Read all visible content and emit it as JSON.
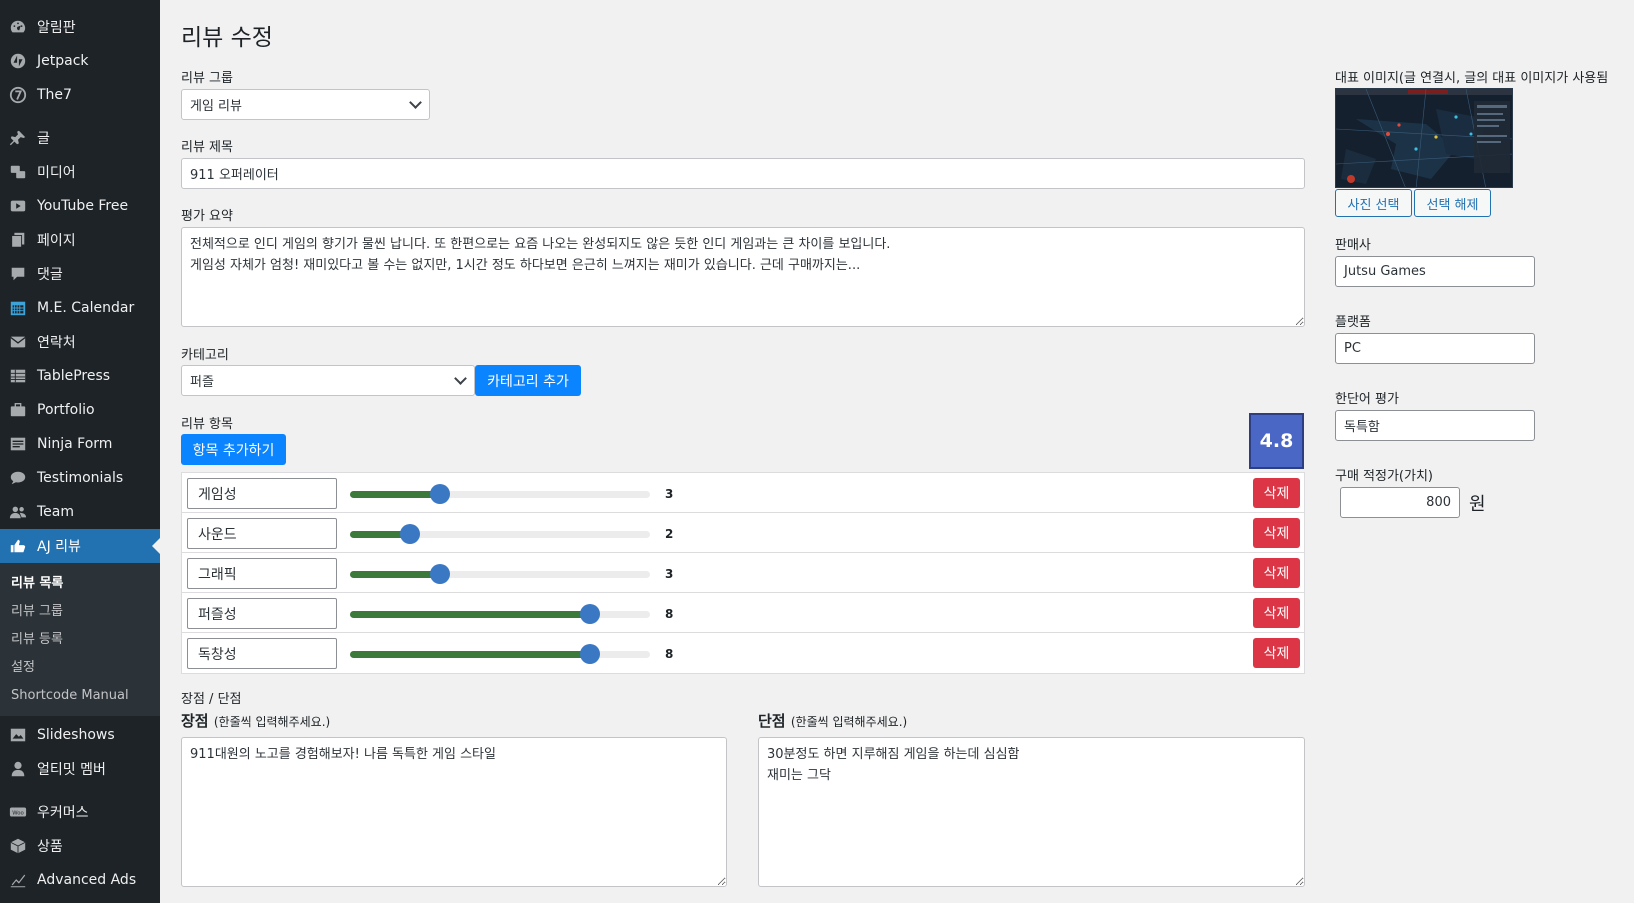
{
  "sidebar": {
    "items": [
      {
        "label": "알림판",
        "icon": "dashboard-icon"
      },
      {
        "label": "Jetpack",
        "icon": "jetpack-icon"
      },
      {
        "label": "The7",
        "icon": "the7-icon"
      },
      {
        "label": "글",
        "icon": "pin-icon"
      },
      {
        "label": "미디어",
        "icon": "media-icon"
      },
      {
        "label": "YouTube Free",
        "icon": "youtube-icon"
      },
      {
        "label": "페이지",
        "icon": "page-icon"
      },
      {
        "label": "댓글",
        "icon": "comment-icon"
      },
      {
        "label": "M.E. Calendar",
        "icon": "calendar-icon"
      },
      {
        "label": "연락처",
        "icon": "mail-icon"
      },
      {
        "label": "TablePress",
        "icon": "table-icon"
      },
      {
        "label": "Portfolio",
        "icon": "portfolio-icon"
      },
      {
        "label": "Ninja Form",
        "icon": "form-icon"
      },
      {
        "label": "Testimonials",
        "icon": "testimonial-icon"
      },
      {
        "label": "Team",
        "icon": "team-icon"
      },
      {
        "label": "AJ 리뷰",
        "icon": "thumbs-up-icon"
      },
      {
        "label": "Slideshows",
        "icon": "slideshow-icon"
      },
      {
        "label": "얼티밋 멤버",
        "icon": "member-icon"
      },
      {
        "label": "우커머스",
        "icon": "woocommerce-icon"
      },
      {
        "label": "상품",
        "icon": "product-icon"
      },
      {
        "label": "Advanced Ads",
        "icon": "chart-icon"
      }
    ],
    "submenu": [
      "리뷰 목록",
      "리뷰 그룹",
      "리뷰 등록",
      "설정",
      "Shortcode Manual"
    ]
  },
  "page": {
    "title": "리뷰 수정",
    "group_label": "리뷰 그룹",
    "group_value": "게임 리뷰",
    "title_label": "리뷰 제목",
    "title_value": "911 오퍼레이터",
    "summary_label": "평가 요약",
    "summary_value": "전체적으로 인디 게임의 향기가 물씬 납니다. 또 한편으로는 요즘 나오는 완성되지도 않은 듯한 인디 게임과는 큰 차이를 보입니다.\n게임성 자체가 엄청! 재미있다고 볼 수는 없지만, 1시간 정도 하다보면 은근히 느껴지는 재미가 있습니다. 근데 구매까지는...",
    "category_label": "카테고리",
    "category_value": "퍼즐",
    "category_add": "카테고리 추가",
    "items_label": "리뷰 항목",
    "items_add": "항목 추가하기",
    "score": "4.8",
    "items": [
      {
        "name": "게임성",
        "value": 3
      },
      {
        "name": "사운드",
        "value": 2
      },
      {
        "name": "그래픽",
        "value": 3
      },
      {
        "name": "퍼즐성",
        "value": 8
      },
      {
        "name": "독창성",
        "value": 8
      }
    ],
    "delete_label": "삭제",
    "slider_max": 10,
    "proscons_label": "장점 / 단점",
    "pros_title": "장점",
    "pros_hint": "(한줄씩 입력해주세요.)",
    "pros_value": "911대원의 노고를 경험해보자! 나름 독특한 게임 스타일",
    "cons_title": "단점",
    "cons_hint": "(한줄씩 입력해주세요.)",
    "cons_value": "30분정도 하면 지루해짐 게임을 하는데 심심함\n재미는 그닥"
  },
  "right": {
    "image_label": "대표 이미지(글 연결시, 글의 대표 이미지가 사용됨",
    "select_photo": "사진 선택",
    "unselect": "선택 해제",
    "seller_label": "판매사",
    "seller_value": "Jutsu Games",
    "platform_label": "플랫폼",
    "platform_value": "PC",
    "oneword_label": "한단어 평가",
    "oneword_value": "독특함",
    "price_label": "구매 적정가(가치)",
    "price_value": "800",
    "price_unit": "원"
  },
  "colors": {
    "sidebar_bg": "#1d2327",
    "active": "#2271b1",
    "primary_btn": "#0b84ff",
    "delete_btn": "#dc3545",
    "score_bg": "#4a67c6",
    "slider_fill": "#3c7a3c",
    "slider_thumb": "#3a78c4"
  }
}
